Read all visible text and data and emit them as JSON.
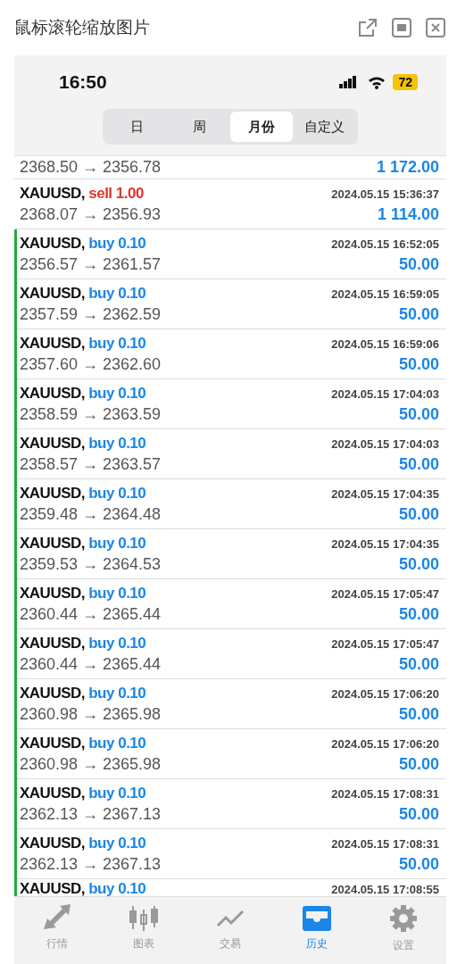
{
  "window": {
    "title": "鼠标滚轮缩放图片"
  },
  "status_bar": {
    "time": "16:50",
    "battery": "72"
  },
  "segments": [
    {
      "label": "日",
      "selected": false
    },
    {
      "label": "周",
      "selected": false
    },
    {
      "label": "月份",
      "selected": true
    },
    {
      "label": "自定义",
      "selected": false
    }
  ],
  "trades": [
    {
      "kind": "sell",
      "prices": "2368.50 → 2356.78",
      "profit": "1 172.00"
    },
    {
      "kind": "sell",
      "symbol": "XAUUSD,",
      "order": "sell 1.00",
      "time": "2024.05.15 15:36:37",
      "prices": "2368.07 → 2356.93",
      "profit": "1 114.00"
    },
    {
      "kind": "buy",
      "symbol": "XAUUSD,",
      "order": "buy 0.10",
      "time": "2024.05.15 16:52:05",
      "prices": "2356.57 → 2361.57",
      "profit": "50.00"
    },
    {
      "kind": "buy",
      "symbol": "XAUUSD,",
      "order": "buy 0.10",
      "time": "2024.05.15 16:59:05",
      "prices": "2357.59 → 2362.59",
      "profit": "50.00"
    },
    {
      "kind": "buy",
      "symbol": "XAUUSD,",
      "order": "buy 0.10",
      "time": "2024.05.15 16:59:06",
      "prices": "2357.60 → 2362.60",
      "profit": "50.00"
    },
    {
      "kind": "buy",
      "symbol": "XAUUSD,",
      "order": "buy 0.10",
      "time": "2024.05.15 17:04:03",
      "prices": "2358.59 → 2363.59",
      "profit": "50.00"
    },
    {
      "kind": "buy",
      "symbol": "XAUUSD,",
      "order": "buy 0.10",
      "time": "2024.05.15 17:04:03",
      "prices": "2358.57 → 2363.57",
      "profit": "50.00"
    },
    {
      "kind": "buy",
      "symbol": "XAUUSD,",
      "order": "buy 0.10",
      "time": "2024.05.15 17:04:35",
      "prices": "2359.48 → 2364.48",
      "profit": "50.00"
    },
    {
      "kind": "buy",
      "symbol": "XAUUSD,",
      "order": "buy 0.10",
      "time": "2024.05.15 17:04:35",
      "prices": "2359.53 → 2364.53",
      "profit": "50.00"
    },
    {
      "kind": "buy",
      "symbol": "XAUUSD,",
      "order": "buy 0.10",
      "time": "2024.05.15 17:05:47",
      "prices": "2360.44 → 2365.44",
      "profit": "50.00"
    },
    {
      "kind": "buy",
      "symbol": "XAUUSD,",
      "order": "buy 0.10",
      "time": "2024.05.15 17:05:47",
      "prices": "2360.44 → 2365.44",
      "profit": "50.00"
    },
    {
      "kind": "buy",
      "symbol": "XAUUSD,",
      "order": "buy 0.10",
      "time": "2024.05.15 17:06:20",
      "prices": "2360.98 → 2365.98",
      "profit": "50.00"
    },
    {
      "kind": "buy",
      "symbol": "XAUUSD,",
      "order": "buy 0.10",
      "time": "2024.05.15 17:06:20",
      "prices": "2360.98 → 2365.98",
      "profit": "50.00"
    },
    {
      "kind": "buy",
      "symbol": "XAUUSD,",
      "order": "buy 0.10",
      "time": "2024.05.15 17:08:31",
      "prices": "2362.13 → 2367.13",
      "profit": "50.00"
    },
    {
      "kind": "buy",
      "symbol": "XAUUSD,",
      "order": "buy 0.10",
      "time": "2024.05.15 17:08:31",
      "prices": "2362.13 → 2367.13",
      "profit": "50.00"
    },
    {
      "kind": "buy",
      "symbol": "XAUUSD,",
      "order": "buy 0.10",
      "time": "2024.05.15 17:08:55"
    }
  ],
  "tab_bar": [
    {
      "kind": "arrows",
      "label": "行情",
      "selected": false
    },
    {
      "kind": "candles",
      "label": "图表",
      "selected": false
    },
    {
      "kind": "trade",
      "label": "交易",
      "selected": false
    },
    {
      "kind": "tray",
      "label": "历史",
      "selected": true
    },
    {
      "kind": "gear",
      "label": "设置",
      "selected": false
    }
  ]
}
